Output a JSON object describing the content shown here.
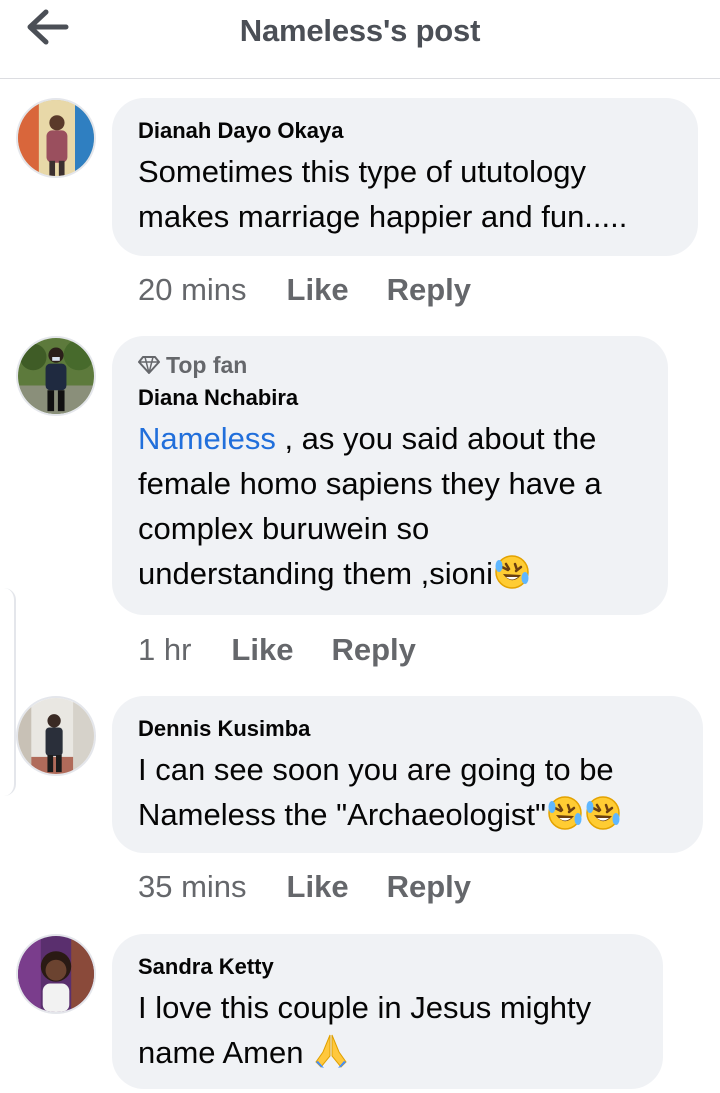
{
  "header": {
    "title": "Nameless's post"
  },
  "comments": [
    {
      "author": "Dianah Dayo Okaya",
      "text": "Sometimes this type of ututology\nmakes marriage happier and fun.....",
      "time": "20 mins",
      "like": "Like",
      "reply": "Reply"
    },
    {
      "badge": "Top fan",
      "author": "Diana Nchabira",
      "mention": "Nameless",
      "text": " , as you said about the\nfemale homo sapiens they have a\ncomplex buruwein so\nunderstanding them ,sioni",
      "time": "1 hr",
      "like": "Like",
      "reply": "Reply"
    },
    {
      "author": "Dennis Kusimba",
      "text": "I can see soon you are going to be\nNameless the \"Archaeologist\"",
      "time": "35 mins",
      "like": "Like",
      "reply": "Reply"
    },
    {
      "author": "Sandra Ketty",
      "text": "I love this couple in Jesus mighty\nname Amen ",
      "time": "",
      "like": "",
      "reply": ""
    }
  ],
  "icons": {
    "back": "arrow-left-icon",
    "badge": "diamond-icon",
    "emoji_laugh": "rolling-on-floor-laughing-emoji",
    "emoji_pray": "folded-hands-emoji"
  },
  "colors": {
    "bubble": "#f0f2f5",
    "mention": "#216fdb",
    "meta_text": "#65676b",
    "header_text": "#4b4f56"
  }
}
